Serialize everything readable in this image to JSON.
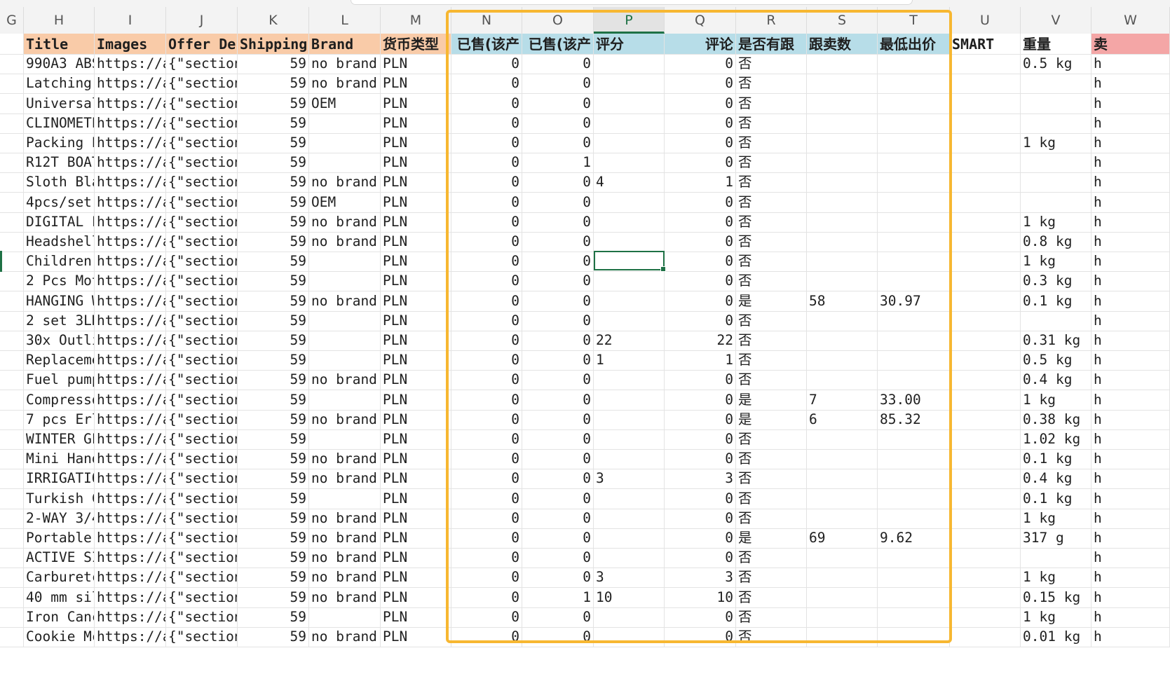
{
  "columns": [
    {
      "letter": "G",
      "header": "",
      "bg": "#ffffff",
      "align": "left"
    },
    {
      "letter": "H",
      "header": "Title",
      "bg": "#f9cba8",
      "align": "left"
    },
    {
      "letter": "I",
      "header": "Images",
      "bg": "#f9cba8",
      "align": "left"
    },
    {
      "letter": "J",
      "header": "Offer De",
      "bg": "#f9cba8",
      "align": "left"
    },
    {
      "letter": "K",
      "header": "Shipping",
      "bg": "#f9cba8",
      "align": "right"
    },
    {
      "letter": "L",
      "header": "Brand",
      "bg": "#f9cba8",
      "align": "left"
    },
    {
      "letter": "M",
      "header": "货币类型",
      "bg": "#f9cba8",
      "align": "left"
    },
    {
      "letter": "N",
      "header": "已售(该产",
      "bg": "#b7dde8",
      "align": "right"
    },
    {
      "letter": "O",
      "header": "已售(该产",
      "bg": "#b7dde8",
      "align": "right"
    },
    {
      "letter": "P",
      "header": "评分",
      "bg": "#b7dde8",
      "align": "left"
    },
    {
      "letter": "Q",
      "header": "评论",
      "bg": "#b7dde8",
      "align": "right"
    },
    {
      "letter": "R",
      "header": "是否有跟",
      "bg": "#b7dde8",
      "align": "left"
    },
    {
      "letter": "S",
      "header": "跟卖数",
      "bg": "#b7dde8",
      "align": "left"
    },
    {
      "letter": "T",
      "header": "最低出价",
      "bg": "#b7dde8",
      "align": "left"
    },
    {
      "letter": "U",
      "header": "SMART",
      "bg": "#ffffff",
      "align": "left"
    },
    {
      "letter": "V",
      "header": "重量",
      "bg": "#ffffff",
      "align": "left"
    },
    {
      "letter": "W",
      "header": "卖",
      "bg": "#f4a6a6",
      "align": "left"
    }
  ],
  "active_column": "P",
  "selected_cell": {
    "row": 11,
    "col": "P"
  },
  "rows": [
    [
      "",
      "990A3 ABS",
      "https://a",
      "{\"section",
      "59",
      "no brand",
      "PLN",
      "0",
      "0",
      "",
      "0",
      "否",
      "",
      "",
      "",
      "0.5 kg",
      "h"
    ],
    [
      "",
      "Latching",
      "https://a",
      "{\"section",
      "59",
      "no brand",
      "PLN",
      "0",
      "0",
      "",
      "0",
      "否",
      "",
      "",
      "",
      "",
      "h"
    ],
    [
      "",
      "Universal",
      "https://a",
      "{\"section",
      "59",
      "OEM",
      "PLN",
      "0",
      "0",
      "",
      "0",
      "否",
      "",
      "",
      "",
      "",
      "h"
    ],
    [
      "",
      "CLINOMETE",
      "https://a",
      "{\"section",
      "59",
      "",
      "PLN",
      "0",
      "0",
      "",
      "0",
      "否",
      "",
      "",
      "",
      "",
      "h"
    ],
    [
      "",
      "Packing E",
      "https://a",
      "{\"section",
      "59",
      "",
      "PLN",
      "0",
      "0",
      "",
      "0",
      "否",
      "",
      "",
      "",
      "1 kg",
      "h"
    ],
    [
      "",
      "R12T BOAT",
      "https://a",
      "{\"section",
      "59",
      "",
      "PLN",
      "0",
      "1",
      "",
      "0",
      "否",
      "",
      "",
      "",
      "",
      "h"
    ],
    [
      "",
      "Sloth Bla",
      "https://a",
      "{\"section",
      "59",
      "no brand",
      "PLN",
      "0",
      "0",
      "4",
      "1",
      "否",
      "",
      "",
      "",
      "",
      "h"
    ],
    [
      "",
      "4pcs/set",
      "https://a",
      "{\"section",
      "59",
      "OEM",
      "PLN",
      "0",
      "0",
      "",
      "0",
      "否",
      "",
      "",
      "",
      "",
      "h"
    ],
    [
      "",
      "DIGITAL F",
      "https://a",
      "{\"section",
      "59",
      "no brand",
      "PLN",
      "0",
      "0",
      "",
      "0",
      "否",
      "",
      "",
      "",
      "1 kg",
      "h"
    ],
    [
      "",
      "Headshell",
      "https://a",
      "{\"section",
      "59",
      "no brand",
      "PLN",
      "0",
      "0",
      "",
      "0",
      "否",
      "",
      "",
      "",
      "0.8 kg",
      "h"
    ],
    [
      "",
      "Children'",
      "https://a",
      "{\"section",
      "59",
      "",
      "PLN",
      "0",
      "0",
      "",
      "0",
      "否",
      "",
      "",
      "",
      "1 kg",
      "h"
    ],
    [
      "",
      "2 Pcs Mot",
      "https://a",
      "{\"section",
      "59",
      "",
      "PLN",
      "0",
      "0",
      "",
      "0",
      "否",
      "",
      "",
      "",
      "0.3 kg",
      "h"
    ],
    [
      "",
      "HANGING W",
      "https://a",
      "{\"section",
      "59",
      "no brand",
      "PLN",
      "0",
      "0",
      "",
      "0",
      "是",
      "58",
      "30.97",
      "",
      "0.1 kg",
      "h"
    ],
    [
      "",
      "2 set 3LD",
      "https://a",
      "{\"section",
      "59",
      "",
      "PLN",
      "0",
      "0",
      "",
      "0",
      "否",
      "",
      "",
      "",
      "",
      "h"
    ],
    [
      "",
      "30x Outli",
      "https://a",
      "{\"section",
      "59",
      "",
      "PLN",
      "0",
      "0",
      "22",
      "22",
      "否",
      "",
      "",
      "",
      "0.31 kg",
      "h"
    ],
    [
      "",
      "Replaceme",
      "https://a",
      "{\"section",
      "59",
      "",
      "PLN",
      "0",
      "0",
      "1",
      "1",
      "否",
      "",
      "",
      "",
      "0.5 kg",
      "h"
    ],
    [
      "",
      "Fuel pump",
      "https://a",
      "{\"section",
      "59",
      "no brand",
      "PLN",
      "0",
      "0",
      "",
      "0",
      "否",
      "",
      "",
      "",
      "0.4 kg",
      "h"
    ],
    [
      "",
      "Compresso",
      "https://a",
      "{\"section",
      "59",
      "",
      "PLN",
      "0",
      "0",
      "",
      "0",
      "是",
      "7",
      "33.00",
      "",
      "1 kg",
      "h"
    ],
    [
      "",
      "7 pcs Erl",
      "https://a",
      "{\"section",
      "59",
      "no brand",
      "PLN",
      "0",
      "0",
      "",
      "0",
      "是",
      "6",
      "85.32",
      "",
      "0.38 kg",
      "h"
    ],
    [
      "",
      "WINTER GL",
      "https://a",
      "{\"section",
      "59",
      "",
      "PLN",
      "0",
      "0",
      "",
      "0",
      "否",
      "",
      "",
      "",
      "1.02 kg",
      "h"
    ],
    [
      "",
      "Mini Hand",
      "https://a",
      "{\"section",
      "59",
      "no brand",
      "PLN",
      "0",
      "0",
      "",
      "0",
      "否",
      "",
      "",
      "",
      "0.1 kg",
      "h"
    ],
    [
      "",
      "IRRIGATIO",
      "https://a",
      "{\"section",
      "59",
      "no brand",
      "PLN",
      "0",
      "0",
      "3",
      "3",
      "否",
      "",
      "",
      "",
      "0.4 kg",
      "h"
    ],
    [
      "",
      "Turkish C",
      "https://a",
      "{\"section",
      "59",
      "",
      "PLN",
      "0",
      "0",
      "",
      "0",
      "否",
      "",
      "",
      "",
      "0.1 kg",
      "h"
    ],
    [
      "",
      "2-WAY 3/4",
      "https://a",
      "{\"section",
      "59",
      "no brand",
      "PLN",
      "0",
      "0",
      "",
      "0",
      "否",
      "",
      "",
      "",
      "1 kg",
      "h"
    ],
    [
      "",
      "Portable",
      "https://a",
      "{\"section",
      "59",
      "no brand",
      "PLN",
      "0",
      "0",
      "",
      "0",
      "是",
      "69",
      "9.62",
      "",
      "317 g",
      "h"
    ],
    [
      "",
      "ACTIVE SI",
      "https://a",
      "{\"section",
      "59",
      "no brand",
      "PLN",
      "0",
      "0",
      "",
      "0",
      "否",
      "",
      "",
      "",
      "",
      "h"
    ],
    [
      "",
      "Carburetc",
      "https://a",
      "{\"section",
      "59",
      "no brand",
      "PLN",
      "0",
      "0",
      "3",
      "3",
      "否",
      "",
      "",
      "",
      "1 kg",
      "h"
    ],
    [
      "",
      "40 mm sil",
      "https://a",
      "{\"section",
      "59",
      "no brand",
      "PLN",
      "0",
      "1",
      "10",
      "10",
      "否",
      "",
      "",
      "",
      "0.15 kg",
      "h"
    ],
    [
      "",
      "Iron Canc",
      "https://a",
      "{\"section",
      "59",
      "",
      "PLN",
      "0",
      "0",
      "",
      "0",
      "否",
      "",
      "",
      "",
      "1 kg",
      "h"
    ],
    [
      "",
      "Cookie Mc",
      "https://a",
      "{\"section",
      "59",
      "no brand",
      "PLN",
      "0",
      "0",
      "",
      "0",
      "否",
      "",
      "",
      "",
      "0.01 kg",
      "h"
    ]
  ]
}
